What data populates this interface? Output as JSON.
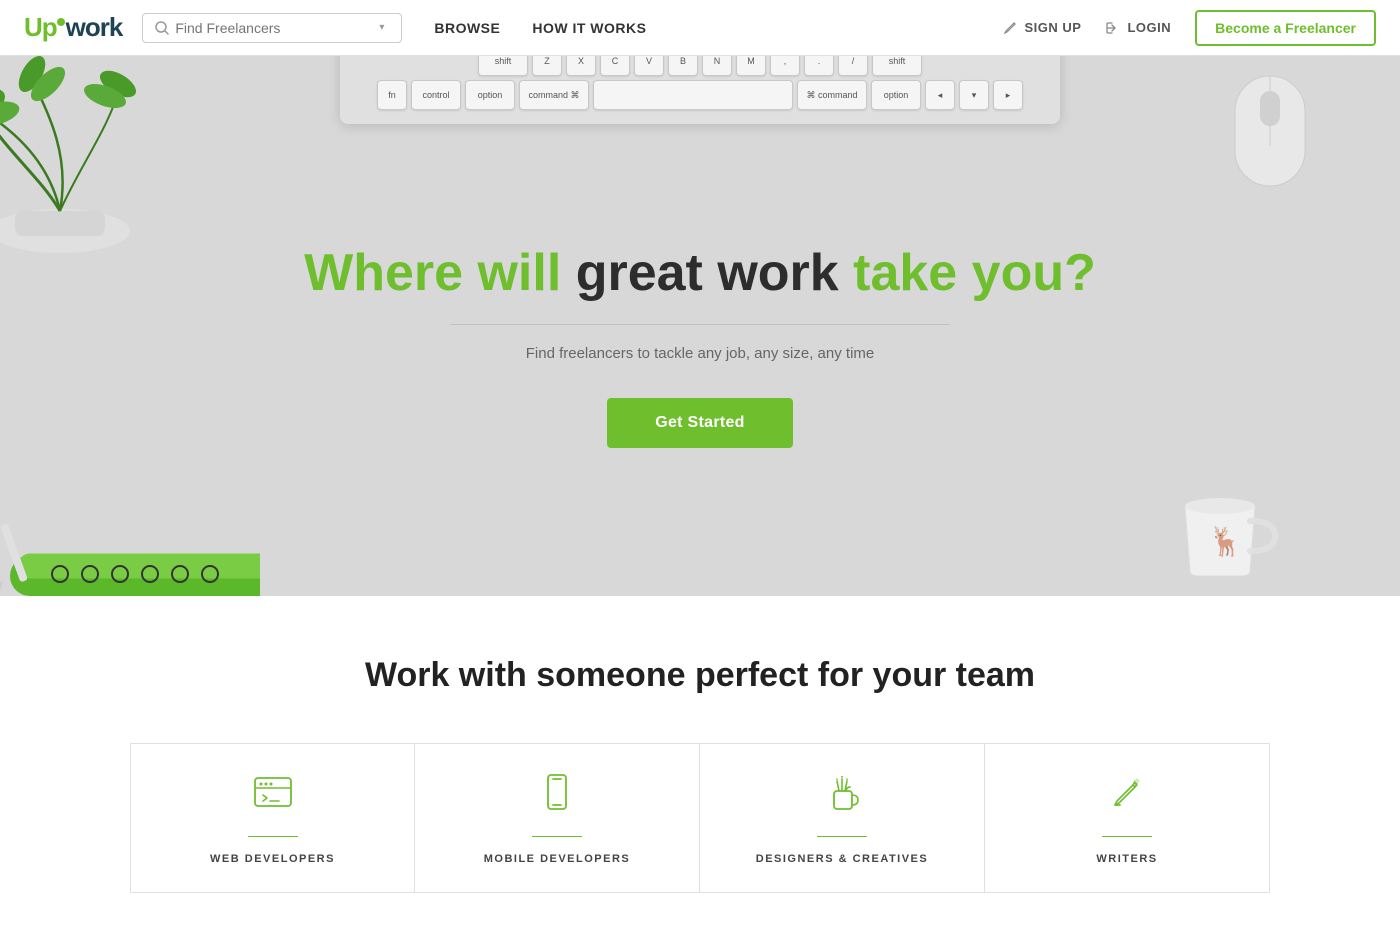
{
  "header": {
    "logo_up": "Up",
    "logo_work": "work",
    "search_placeholder": "Find Freelancers",
    "nav": [
      {
        "label": "BROWSE",
        "key": "browse"
      },
      {
        "label": "HOW IT WORKS",
        "key": "how-it-works"
      }
    ],
    "signup_label": "SIGN UP",
    "login_label": "LOGIN",
    "become_label": "Become a Freelancer"
  },
  "hero": {
    "title_part1": "Where will ",
    "title_part2": "great work",
    "title_part3": " take you?",
    "subtitle": "Find freelancers to tackle any job, any size, any time",
    "cta_label": "Get Started"
  },
  "section2": {
    "title": "Work with someone perfect for your team",
    "categories": [
      {
        "label": "WEB DEVELOPERS",
        "icon": "terminal-icon"
      },
      {
        "label": "MOBILE DEVELOPERS",
        "icon": "mobile-icon"
      },
      {
        "label": "DESIGNERS & CREATIVES",
        "icon": "design-icon"
      },
      {
        "label": "WRITERS",
        "icon": "pencil-icon"
      }
    ]
  }
}
